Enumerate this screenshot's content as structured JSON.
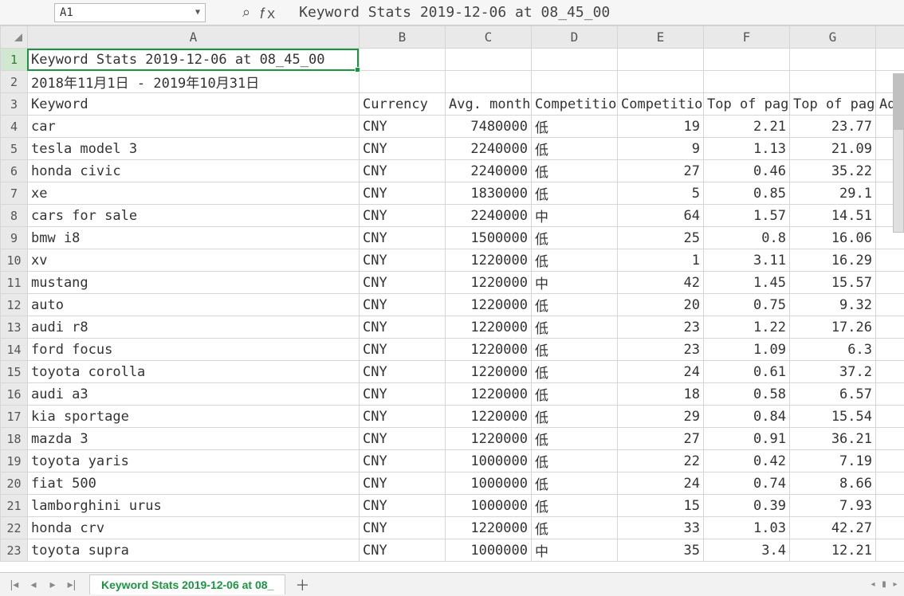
{
  "name_box": "A1",
  "formula_bar": "Keyword Stats 2019-12-06 at 08_45_00",
  "columns": [
    "A",
    "B",
    "C",
    "D",
    "E",
    "F",
    "G"
  ],
  "row1_text": "Keyword Stats 2019-12-06 at 08_45_00",
  "row2_text": "2018年11月1日 - 2019年10月31日",
  "headers": {
    "A": "Keyword",
    "B": "Currency",
    "C": "Avg. month",
    "D": "Competitio",
    "E": "Competitio",
    "F": "Top of pag",
    "G": "Top of pag",
    "H": "Ad"
  },
  "rows": [
    {
      "n": 4,
      "A": "car",
      "B": "CNY",
      "C": "7480000",
      "D": "低",
      "E": "19",
      "F": "2.21",
      "G": "23.77"
    },
    {
      "n": 5,
      "A": "tesla model 3",
      "B": "CNY",
      "C": "2240000",
      "D": "低",
      "E": "9",
      "F": "1.13",
      "G": "21.09"
    },
    {
      "n": 6,
      "A": "honda civic",
      "B": "CNY",
      "C": "2240000",
      "D": "低",
      "E": "27",
      "F": "0.46",
      "G": "35.22"
    },
    {
      "n": 7,
      "A": "xe",
      "B": "CNY",
      "C": "1830000",
      "D": "低",
      "E": "5",
      "F": "0.85",
      "G": "29.1"
    },
    {
      "n": 8,
      "A": "cars for sale",
      "B": "CNY",
      "C": "2240000",
      "D": "中",
      "E": "64",
      "F": "1.57",
      "G": "14.51"
    },
    {
      "n": 9,
      "A": "bmw i8",
      "B": "CNY",
      "C": "1500000",
      "D": "低",
      "E": "25",
      "F": "0.8",
      "G": "16.06"
    },
    {
      "n": 10,
      "A": "xv",
      "B": "CNY",
      "C": "1220000",
      "D": "低",
      "E": "1",
      "F": "3.11",
      "G": "16.29"
    },
    {
      "n": 11,
      "A": "mustang",
      "B": "CNY",
      "C": "1220000",
      "D": "中",
      "E": "42",
      "F": "1.45",
      "G": "15.57"
    },
    {
      "n": 12,
      "A": "auto",
      "B": "CNY",
      "C": "1220000",
      "D": "低",
      "E": "20",
      "F": "0.75",
      "G": "9.32"
    },
    {
      "n": 13,
      "A": "audi r8",
      "B": "CNY",
      "C": "1220000",
      "D": "低",
      "E": "23",
      "F": "1.22",
      "G": "17.26"
    },
    {
      "n": 14,
      "A": "ford focus",
      "B": "CNY",
      "C": "1220000",
      "D": "低",
      "E": "23",
      "F": "1.09",
      "G": "6.3"
    },
    {
      "n": 15,
      "A": "toyota corolla",
      "B": "CNY",
      "C": "1220000",
      "D": "低",
      "E": "24",
      "F": "0.61",
      "G": "37.2"
    },
    {
      "n": 16,
      "A": "audi a3",
      "B": "CNY",
      "C": "1220000",
      "D": "低",
      "E": "18",
      "F": "0.58",
      "G": "6.57"
    },
    {
      "n": 17,
      "A": "kia sportage",
      "B": "CNY",
      "C": "1220000",
      "D": "低",
      "E": "29",
      "F": "0.84",
      "G": "15.54"
    },
    {
      "n": 18,
      "A": "mazda 3",
      "B": "CNY",
      "C": "1220000",
      "D": "低",
      "E": "27",
      "F": "0.91",
      "G": "36.21"
    },
    {
      "n": 19,
      "A": "toyota yaris",
      "B": "CNY",
      "C": "1000000",
      "D": "低",
      "E": "22",
      "F": "0.42",
      "G": "7.19"
    },
    {
      "n": 20,
      "A": "fiat 500",
      "B": "CNY",
      "C": "1000000",
      "D": "低",
      "E": "24",
      "F": "0.74",
      "G": "8.66"
    },
    {
      "n": 21,
      "A": "lamborghini urus",
      "B": "CNY",
      "C": "1000000",
      "D": "低",
      "E": "15",
      "F": "0.39",
      "G": "7.93"
    },
    {
      "n": 22,
      "A": "honda crv",
      "B": "CNY",
      "C": "1220000",
      "D": "低",
      "E": "33",
      "F": "1.03",
      "G": "42.27"
    },
    {
      "n": 23,
      "A": "toyota supra",
      "B": "CNY",
      "C": "1000000",
      "D": "中",
      "E": "35",
      "F": "3.4",
      "G": "12.21"
    }
  ],
  "sheet_tab": "Keyword Stats 2019-12-06 at 08_",
  "selection": {
    "row": 1,
    "col": "A"
  }
}
